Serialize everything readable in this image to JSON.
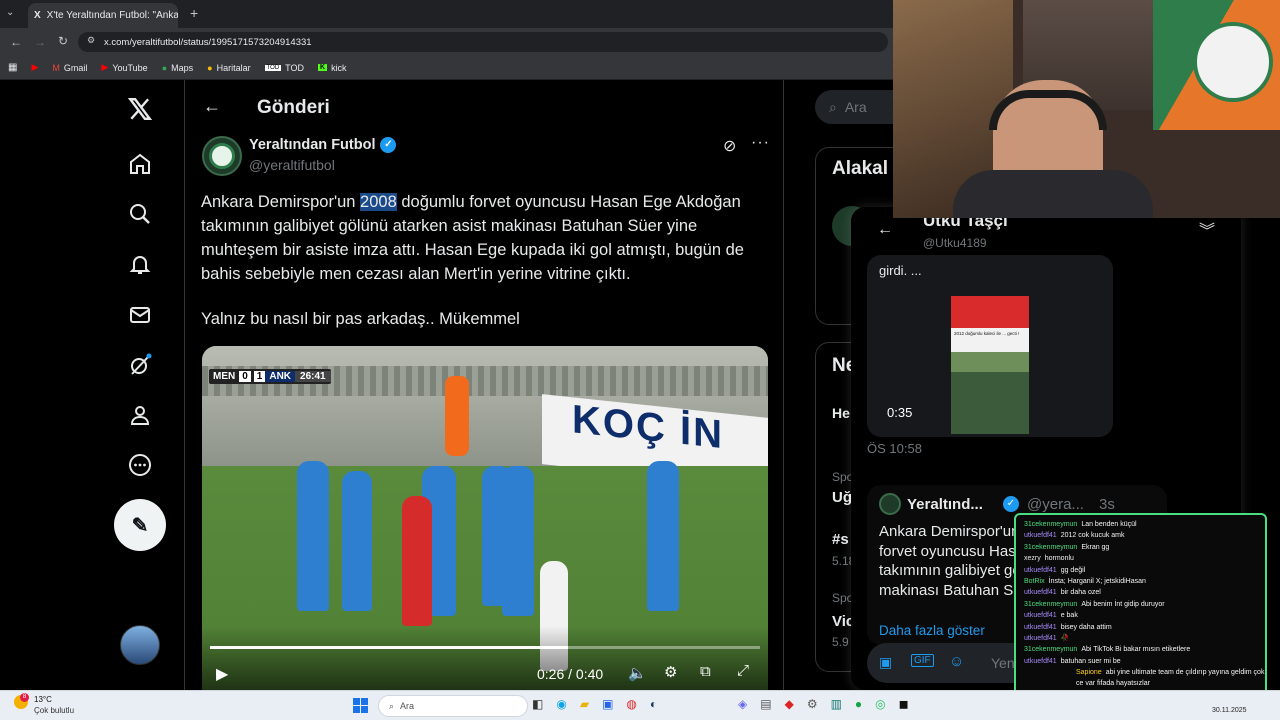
{
  "browser": {
    "tab_title": "X'te Yeraltından Futbol: \"Ankara",
    "url": "x.com/yeraltifutbol/status/1995171573204914331",
    "bookmarks": [
      "Gmail",
      "YouTube",
      "Maps",
      "Haritalar",
      "TOD",
      "kick"
    ]
  },
  "header": {
    "title": "Gönderi"
  },
  "search": {
    "placeholder": "Ara"
  },
  "tweet": {
    "display_name": "Yeraltından Futbol",
    "handle": "@yeraltifutbol",
    "text_pre": "Ankara Demirspor'un ",
    "text_highlight": "2008",
    "text_post": " doğumlu forvet oyuncusu Hasan Ege Akdoğan takımının galibiyet gölünü atarken asist makinası Batuhan Süer yine muhteşem bir asiste imza attı. Hasan Ege kupada iki gol atmıştı, bugün de bahis sebebiyle men cezası alan Mert'in yerine vitrine çıktı.",
    "text_line2": "Yalnız bu nasıl bir pas arkadaş.. Mükemmel",
    "video": {
      "score_home_team": "MEN",
      "score_home": "0",
      "score_away": "1",
      "score_away_team": "ANK",
      "match_clock": "26:41",
      "time": "0:26 / 0:40",
      "progress": 0.65,
      "banner": "KOÇ İN"
    }
  },
  "right_sidebar": {
    "relevant_title": "Alakal",
    "news_title": "Ne",
    "items": [
      {
        "cat": "Spo",
        "title": "Uğ"
      },
      {
        "cat": "",
        "title": "#s",
        "count": "5.18"
      },
      {
        "cat": "Spo",
        "title": "Vic",
        "count": "5.9"
      }
    ],
    "he_label": "He"
  },
  "dm_panel": {
    "user": "Utku Taşçı",
    "handle": "@Utku4189",
    "snippet": "girdi. ...",
    "video_duration": "0:35",
    "video_caption": "2012 doğumlu kaleci ile ... gecti !",
    "timestamp": "ÖS 10:58",
    "quoted_name": "Yeraltınd...",
    "quoted_handle": "@yera...",
    "quoted_age": "3s",
    "quoted_text": "Ankara Demirspor'un 2008 doğumlu forvet oyuncusu Hasan Ege Akdoğan takımının galibiyet gölünü atarken asist makinası Batuhan Süer",
    "show_more": "Daha fazla göster",
    "compose_placeholder": "Yeni"
  },
  "chat": [
    {
      "user": "31cekenmeymun",
      "msg": "Lan benden küçül",
      "color": "#4ade80"
    },
    {
      "user": "utkuefdf41",
      "msg": "2012 cok kucuk amk",
      "color": "#a78bfa"
    },
    {
      "user": "31cekenmeymun",
      "msg": "Ekran gg",
      "color": "#4ade80"
    },
    {
      "user": "xezry",
      "msg": "hormonlu",
      "color": "#e5e7eb"
    },
    {
      "user": "utkuefdf41",
      "msg": "gg değil",
      "color": "#a78bfa"
    },
    {
      "user": "BotRix",
      "msg": "İnsta; Harganil X; jetskidiHasan",
      "color": "#4ade80"
    },
    {
      "user": "utkuefdf41",
      "msg": "bir daha ozel",
      "color": "#a78bfa"
    },
    {
      "user": "31cekenmeymun",
      "msg": "Abi benim İnt gidip duruyor",
      "color": "#4ade80"
    },
    {
      "user": "utkuefdf41",
      "msg": "e bak",
      "color": "#a78bfa"
    },
    {
      "user": "utkuefdf41",
      "msg": "bisey daha attim",
      "color": "#a78bfa"
    },
    {
      "user": "utkuefdf41",
      "msg": "🥀",
      "color": "#a78bfa"
    },
    {
      "user": "31cekenmeymun",
      "msg": "Abi TikTok Bi bakar mısın etiketlere",
      "color": "#4ade80"
    },
    {
      "user": "utkuefdf41",
      "msg": "batuhan suer mi be",
      "color": "#a78bfa"
    },
    {
      "user": "Sapione",
      "msg": "abi yine ultimate team de çıldırıp yayına geldim çok ce var fifada hayatsızlar",
      "color": "#facc15"
    }
  ],
  "taskbar": {
    "weather_temp": "13°C",
    "weather_desc": "Çok bulutlu",
    "notification_count": "8",
    "search_label": "Ara",
    "date": "30.11.2025"
  },
  "brand": {
    "x_blue": "#1d9bf0",
    "verified": "#1d9bf0"
  }
}
